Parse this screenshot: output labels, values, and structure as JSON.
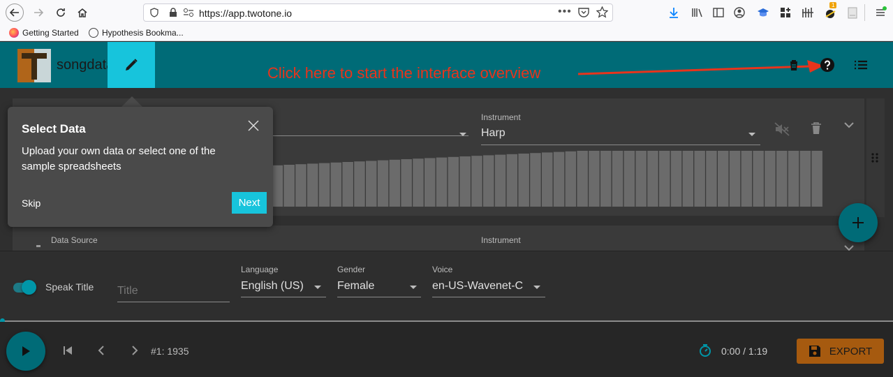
{
  "browser": {
    "url": "https://app.twotone.io",
    "bookmarks": [
      "Getting Started",
      "Hypothesis Bookma..."
    ],
    "badge_count": "1"
  },
  "header": {
    "title": "songdata",
    "annotation": "Click here to start the interface overview",
    "annotation_color": "#e8341c",
    "accent": "#006b77"
  },
  "tracks": [
    {
      "instrument_label": "Instrument",
      "instrument_value": "Harp",
      "bar_values": [
        0.52,
        0.53,
        0.54,
        0.55,
        0.56,
        0.57,
        0.58,
        0.59,
        0.6,
        0.61,
        0.62,
        0.63,
        0.64,
        0.65,
        0.66,
        0.67,
        0.68,
        0.69,
        0.7,
        0.71,
        0.72,
        0.73,
        0.74,
        0.75,
        0.76,
        0.77,
        0.78,
        0.79,
        0.8,
        0.81,
        0.82,
        0.83,
        0.84,
        0.85,
        0.86,
        0.87,
        0.88,
        0.89,
        0.9,
        0.91,
        0.92,
        0.93,
        0.94,
        0.95,
        0.96,
        0.97,
        0.98,
        0.99,
        1.0,
        1.0,
        1.0,
        1.0,
        1.0,
        1.0,
        1.0,
        1.0,
        1.0,
        1.0,
        1.0,
        1.0,
        1.0,
        1.0,
        1.0,
        1.0,
        1.0,
        1.0,
        1.0,
        1.0,
        1.0
      ]
    },
    {
      "data_source_label": "Data Source",
      "instrument_label": "Instrument"
    }
  ],
  "tooltip": {
    "title": "Select Data",
    "body": "Upload your own data or select one of the sample spreadsheets",
    "skip": "Skip",
    "next": "Next"
  },
  "speak": {
    "toggle_label": "Speak Title",
    "title_placeholder": "Title",
    "language_label": "Language",
    "language_value": "English (US)",
    "gender_label": "Gender",
    "gender_value": "Female",
    "voice_label": "Voice",
    "voice_value": "en-US-Wavenet-C",
    "toggle_on": true
  },
  "transport": {
    "position": "#1: 1935",
    "time": "0:00 / 1:19",
    "export": "EXPORT",
    "export_color": "#a65a0f"
  }
}
